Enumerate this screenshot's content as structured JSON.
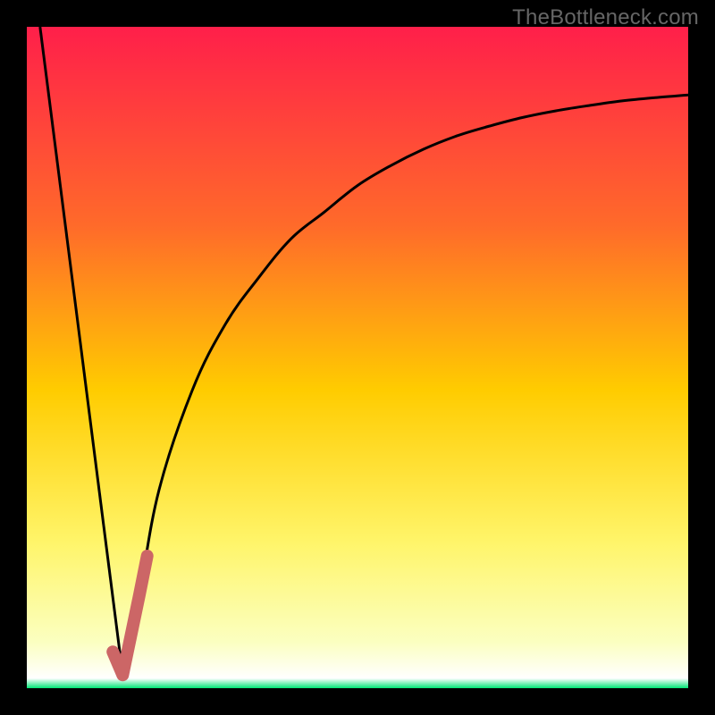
{
  "watermark": "TheBottleneck.com",
  "colors": {
    "frame": "#000000",
    "gradient_top": "#ff1f4a",
    "gradient_upper": "#ff6a2a",
    "gradient_mid": "#ffcc00",
    "gradient_lower": "#fff56a",
    "gradient_pale": "#fbffc0",
    "gradient_bottom": "#00e676",
    "curve": "#000000",
    "highlight": "#cc6666"
  },
  "chart_data": {
    "type": "line",
    "title": "",
    "xlabel": "",
    "ylabel": "",
    "xlim": [
      0,
      100
    ],
    "ylim": [
      0,
      100
    ],
    "series": [
      {
        "name": "left-falling-line",
        "x": [
          2,
          14.5
        ],
        "values": [
          100,
          2
        ]
      },
      {
        "name": "rising-curve",
        "x": [
          14.5,
          17,
          20,
          25,
          30,
          35,
          40,
          45,
          50,
          55,
          60,
          65,
          70,
          75,
          80,
          85,
          90,
          95,
          100
        ],
        "values": [
          2,
          14,
          30,
          45,
          55,
          62,
          68,
          72,
          76,
          79,
          81.5,
          83.5,
          85,
          86.3,
          87.3,
          88.1,
          88.8,
          89.3,
          89.7
        ]
      },
      {
        "name": "highlight-segment",
        "x": [
          13,
          14.5,
          17,
          18.2
        ],
        "values": [
          5.5,
          2,
          14,
          20
        ]
      }
    ],
    "vertex": {
      "x": 14.5,
      "y": 2
    }
  }
}
